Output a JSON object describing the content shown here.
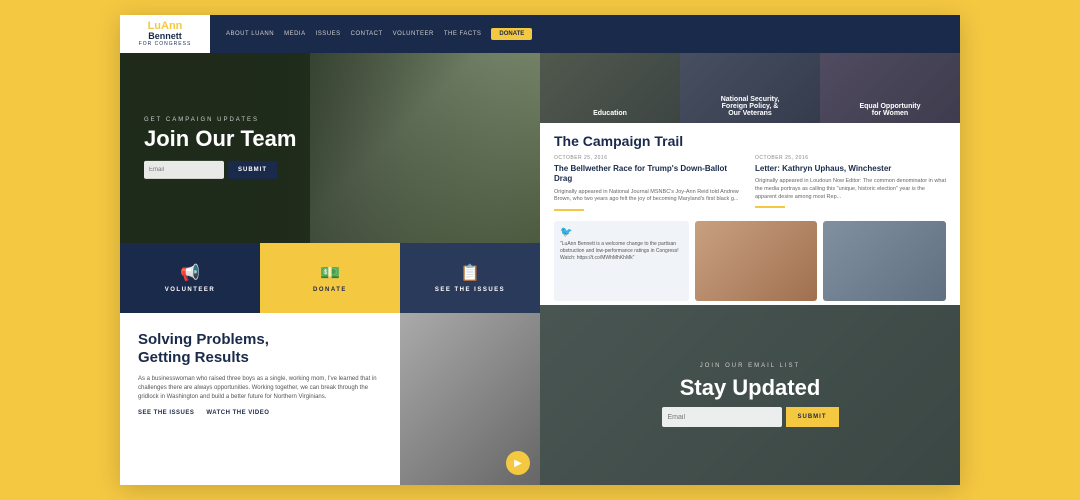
{
  "background": "#F5C842",
  "navbar": {
    "logo_name_line1": "LuAnn",
    "logo_name_line2": "Bennett",
    "logo_subtitle": "FOR CONGRESS",
    "links": [
      "ABOUT LUANN",
      "MEDIA",
      "ISSUES",
      "CONTACT",
      "VOLUNTEER",
      "THE FACTS"
    ],
    "donate_label": "DONATE"
  },
  "hero": {
    "label": "GET CAMPAIGN UPDATES",
    "title": "Join Our Team",
    "input_placeholder": "Email",
    "submit_label": "SUBMIT"
  },
  "cta_buttons": [
    {
      "icon": "📢",
      "label": "VOLUNTEER"
    },
    {
      "icon": "💵",
      "label": "DONATE"
    },
    {
      "icon": "📋",
      "label": "SEE THE ISSUES"
    }
  ],
  "solving": {
    "title": "Solving Problems,\nGetting Results",
    "body": "As a businesswoman who raised three boys as a single, working mom, I've learned that in challenges there are always opportunities. Working together, we can break through the gridlock in Washington and build a better future for Northern Virginians.",
    "see_issues_label": "SEE THE ISSUES",
    "watch_video_label": "WATCH THE VIDEO"
  },
  "top_images": [
    {
      "label": "Education"
    },
    {
      "label": "National Security,\nForeign Policy, &\nOur Veterans"
    },
    {
      "label": "Equal Opportunity\nfor Women"
    }
  ],
  "campaign_trail": {
    "title": "The Campaign Trail",
    "articles": [
      {
        "date": "OCTOBER 25, 2016",
        "title": "The Bellwether Race for Trump's Down-Ballot Drag",
        "body": "Originally appeared in National Journal MSNBC's Joy-Ann Reid told Andrew Brown, who two years ago felt the joy of becoming Maryland's first black g..."
      },
      {
        "date": "OCTOBER 25, 2016",
        "title": "Letter: Kathryn Uphaus, Winchester",
        "body": "Originally appeared in Loudoun Now Editor: The common denominator in what the media portrays as calling this \"unique, historic election\" year is the apparent desire among most Rep..."
      }
    ]
  },
  "social": {
    "twitter_icon": "🐦",
    "text": "\"LuAnn Bennett is a welcome change to the partisan obstruction and low-performance ratings in Congress! Watch: https://t.co/MWhMhKhMk\""
  },
  "stay_updated": {
    "label": "JOIN OUR EMAIL LIST",
    "title": "Stay Updated",
    "input_placeholder": "Email",
    "submit_label": "SUBMIT"
  }
}
